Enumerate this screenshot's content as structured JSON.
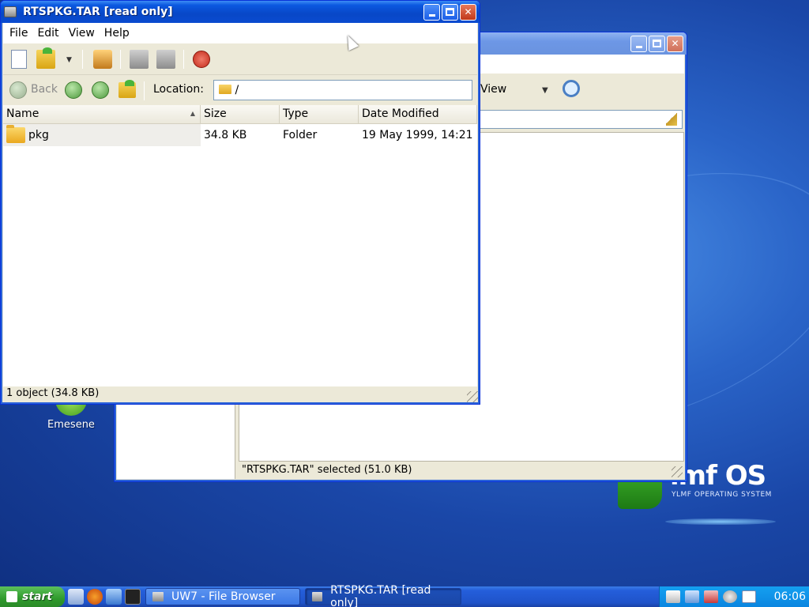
{
  "desktop": {
    "icons": [
      {
        "label": "Emesene",
        "icon": "emesene-icon"
      }
    ],
    "logo": {
      "word": "lmf OS",
      "subtitle": "YLMF OPERATING SYSTEM"
    }
  },
  "back_window": {
    "view_label": "View",
    "status": "\"RTSPKG.TAR\" selected (51.0 KB)"
  },
  "front_window": {
    "title": "RTSPKG.TAR [read only]",
    "menu": [
      "File",
      "Edit",
      "View",
      "Help"
    ],
    "nav": {
      "back_label": "Back",
      "location_label": "Location:",
      "location_value": "/"
    },
    "columns": [
      "Name",
      "Size",
      "Type",
      "Date Modified"
    ],
    "rows": [
      {
        "name": "pkg",
        "size": "34.8 KB",
        "type": "Folder",
        "date": "19 May 1999, 14:21"
      }
    ],
    "status": "1 object (34.8 KB)"
  },
  "taskbar": {
    "start_label": "start",
    "tasks": [
      {
        "label": "UW7 - File Browser",
        "active": false
      },
      {
        "label": "RTSPKG.TAR [read only]",
        "active": true
      }
    ],
    "clock": "06:06"
  },
  "colors": {
    "title_active": "#0a58e0",
    "taskbar": "#245edb",
    "start": "#2f9a2c"
  }
}
